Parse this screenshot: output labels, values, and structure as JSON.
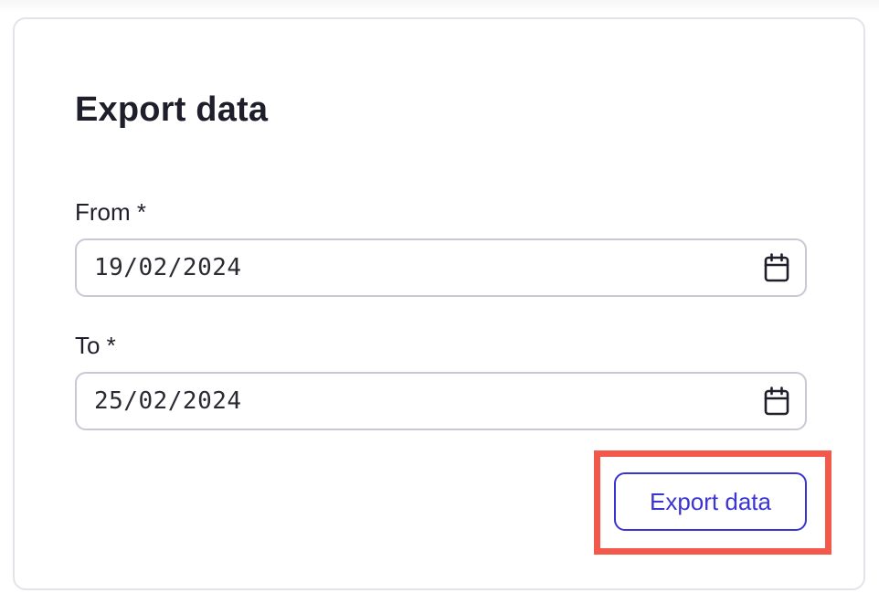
{
  "card": {
    "title": "Export data"
  },
  "form": {
    "from": {
      "label": "From *",
      "value": "19/02/2024",
      "icon": "calendar-icon"
    },
    "to": {
      "label": "To *",
      "value": "25/02/2024",
      "icon": "calendar-icon"
    },
    "submit_label": "Export data"
  },
  "colors": {
    "accent": "#3a34d2",
    "highlight": "#f2594b",
    "border": "#c9c8d6",
    "text": "#1f1f2b"
  }
}
